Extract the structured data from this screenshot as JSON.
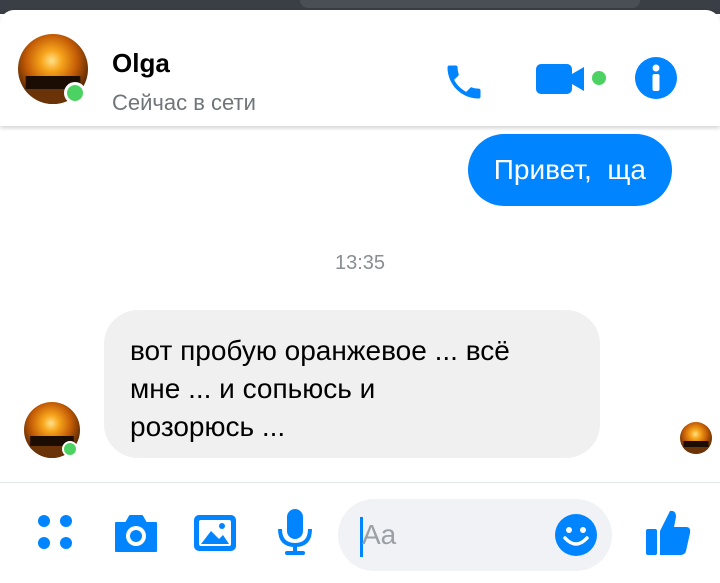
{
  "header": {
    "contact_name": "Olga",
    "contact_status": "Сейчас в сети",
    "buttons": [
      "phone-icon",
      "video-icon",
      "info-icon"
    ]
  },
  "messages": {
    "outgoing": "Привет,  ща",
    "timestamp": "13:35",
    "incoming": "вот пробую оранжевое ... всё\nмне  ... и сопьюсь и\nрозорюсь ..."
  },
  "composer": {
    "placeholder": "Aa",
    "buttons": [
      "apps-icon",
      "camera-icon",
      "gallery-icon",
      "microphone-icon",
      "emoji-icon",
      "thumbs-up-icon"
    ]
  },
  "colors": {
    "accent": "#0084ff",
    "online": "#4cd263",
    "incoming_bubble": "#f0f0f0"
  }
}
